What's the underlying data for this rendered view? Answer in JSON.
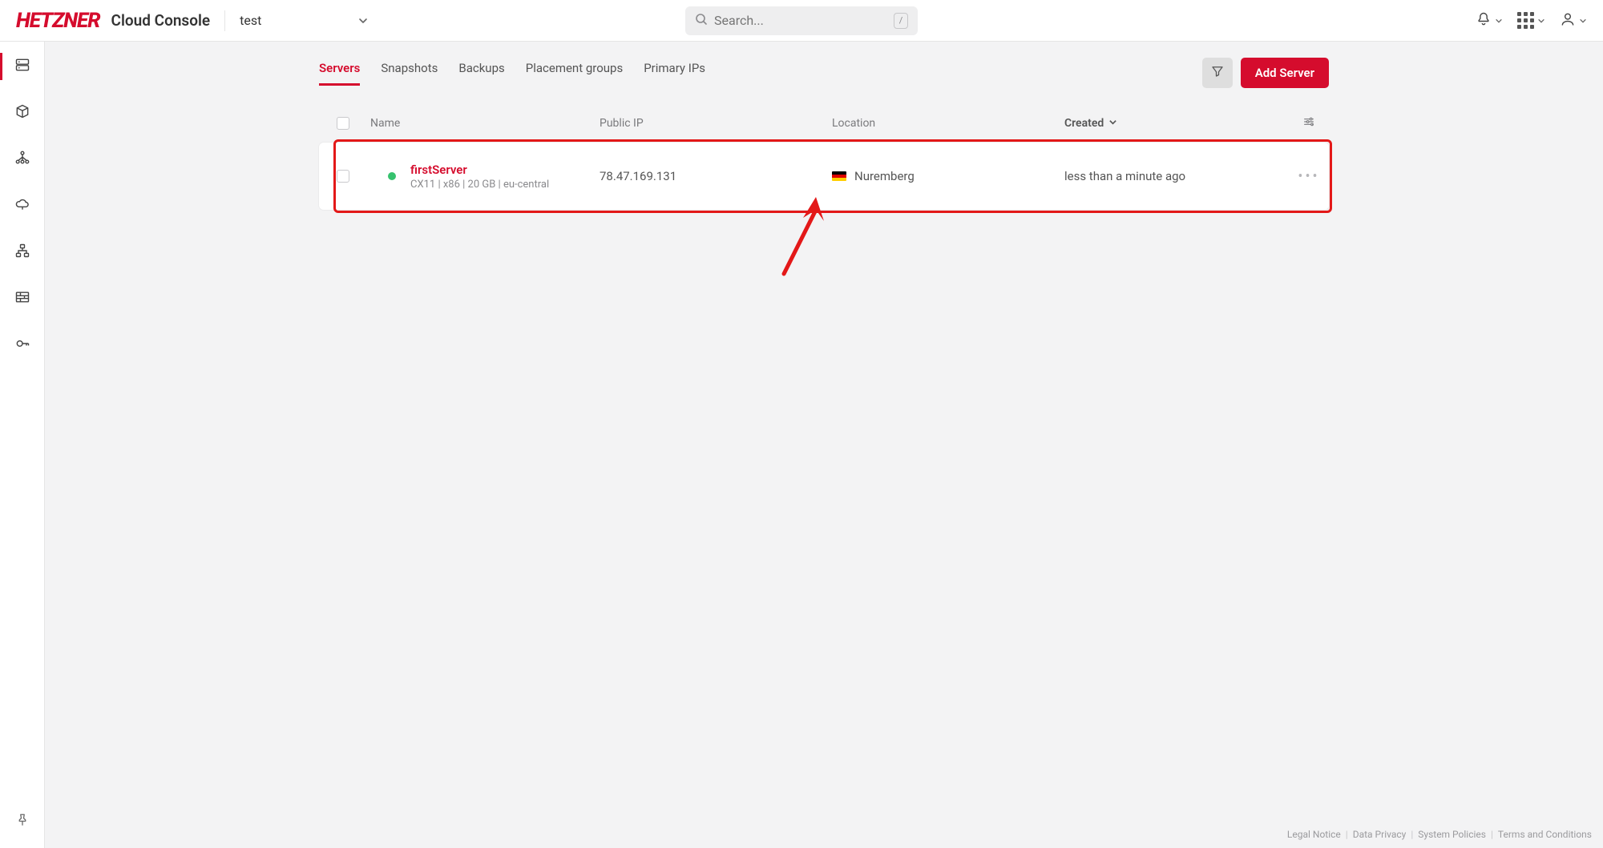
{
  "brand": "HETZNER",
  "console_label": "Cloud Console",
  "project": {
    "name": "test"
  },
  "search": {
    "placeholder": "Search...",
    "shortcut": "/"
  },
  "tabs": [
    {
      "label": "Servers",
      "active": true
    },
    {
      "label": "Snapshots"
    },
    {
      "label": "Backups"
    },
    {
      "label": "Placement groups"
    },
    {
      "label": "Primary IPs"
    }
  ],
  "actions": {
    "add_server": "Add Server"
  },
  "columns": {
    "name": "Name",
    "public_ip": "Public IP",
    "location": "Location",
    "created": "Created"
  },
  "servers": [
    {
      "name": "firstServer",
      "meta": "CX11 | x86 | 20 GB | eu-central",
      "public_ip": "78.47.169.131",
      "location": "Nuremberg",
      "flag": "de",
      "created": "less than a minute ago",
      "status": "running"
    }
  ],
  "footer": {
    "legal_notice": "Legal Notice",
    "data_privacy": "Data Privacy",
    "system_policies": "System Policies",
    "terms": "Terms and Conditions"
  }
}
